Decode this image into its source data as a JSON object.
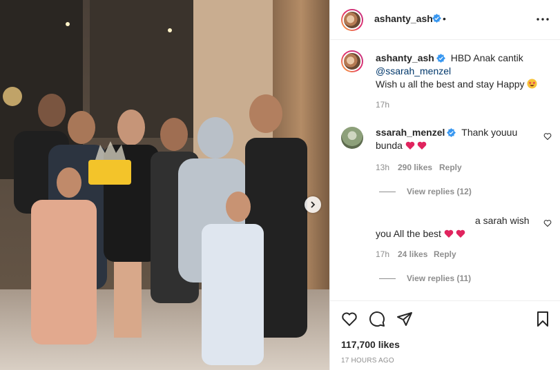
{
  "post": {
    "username": "ashanty_ash",
    "dot": "•",
    "photo_alt": "Family photo with birthday cake"
  },
  "caption": {
    "username": "ashanty_ash",
    "text": "HBD Anak cantik",
    "mention": "@ssarah_menzel",
    "line2": "Wish u all the best and stay Happy",
    "emoji": "star-struck-emoji",
    "age": "17h"
  },
  "comments": [
    {
      "username": "ssarah_menzel",
      "text_line1": "Thank youuu",
      "text_line2": "bunda",
      "emoji": "red-hearts",
      "age": "13h",
      "likes": "290 likes",
      "reply": "Reply",
      "view_replies": "View replies (12)"
    },
    {
      "text_line1": "a sarah wish",
      "text_line2": "you All the best",
      "emoji": "red-hearts",
      "age": "17h",
      "likes": "24 likes",
      "reply": "Reply",
      "view_replies": "View replies (11)"
    }
  ],
  "footer": {
    "likes": "117,700 likes",
    "time": "17 HOURS AGO"
  },
  "colors": {
    "verified": "#3897f0",
    "heart": "#e0245e",
    "muted": "#8e8e8e",
    "link": "#00376b"
  }
}
